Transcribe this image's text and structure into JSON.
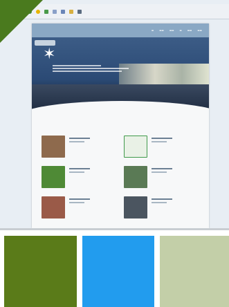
{
  "colors": {
    "green_dark": "#5a7b19",
    "blue": "#229cee",
    "sage": "#c3cfa8",
    "corner": "#4a7a1e",
    "nav": "#8aa8c4"
  },
  "toolbar": {
    "icons": [
      "back-icon",
      "favorites-icon",
      "feed-icon",
      "mail-icon",
      "print-icon",
      "page-icon",
      "tools-icon"
    ]
  },
  "site": {
    "projects_heading": "",
    "cards": [
      {
        "thumb": "#8e6a4d"
      },
      {
        "thumb": "#3f9a4a"
      },
      {
        "thumb": "#4f8a36"
      },
      {
        "thumb": "#5a7a55"
      },
      {
        "thumb": "#9a5a48"
      },
      {
        "thumb": "#4b5560"
      }
    ]
  }
}
